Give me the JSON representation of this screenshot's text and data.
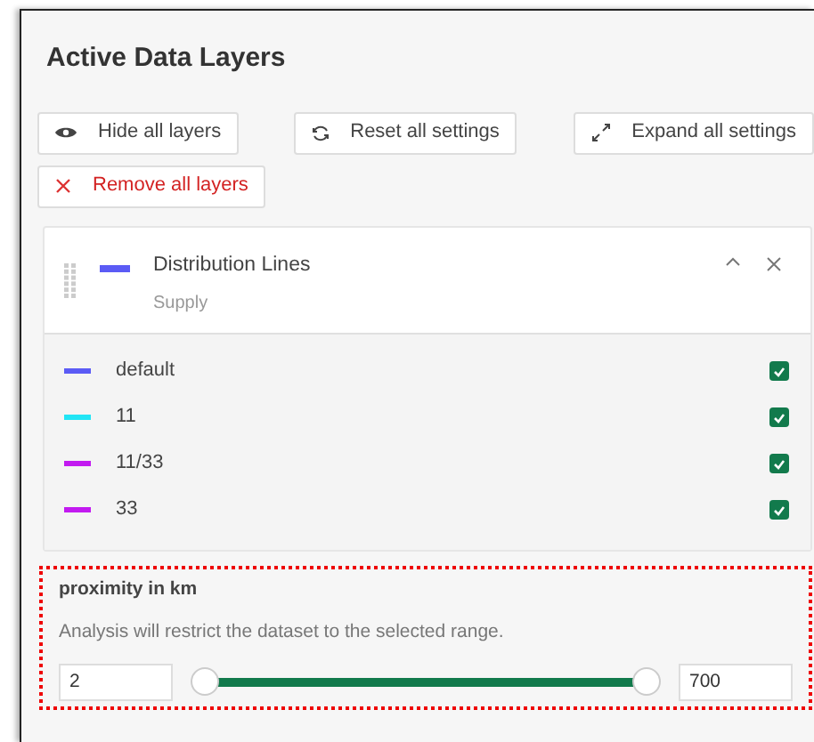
{
  "panel": {
    "title": "Active Data Layers"
  },
  "actions": [
    {
      "kind": "hide",
      "label": "Hide all layers"
    },
    {
      "kind": "reset",
      "label": "Reset all settings"
    },
    {
      "kind": "expand",
      "label": "Expand all settings"
    },
    {
      "kind": "remove",
      "label": "Remove all layers"
    }
  ],
  "layer": {
    "name": "Distribution Lines",
    "subtitle": "Supply",
    "color": "#5b5bf5",
    "expanded": true,
    "legend": [
      {
        "label": "default",
        "color": "#5b5bf5",
        "checked": true
      },
      {
        "label": "11",
        "color": "#22e5f5",
        "checked": true
      },
      {
        "label": "11/33",
        "color": "#c21af0",
        "checked": true
      },
      {
        "label": "33",
        "color": "#c21af0",
        "checked": true
      }
    ]
  },
  "proximity": {
    "title": "proximity in km",
    "description": "Analysis will restrict the dataset to the selected range.",
    "min_value": "2",
    "max_value": "700",
    "thumbs": [
      {
        "level": 0
      },
      {
        "level": 1
      }
    ]
  }
}
